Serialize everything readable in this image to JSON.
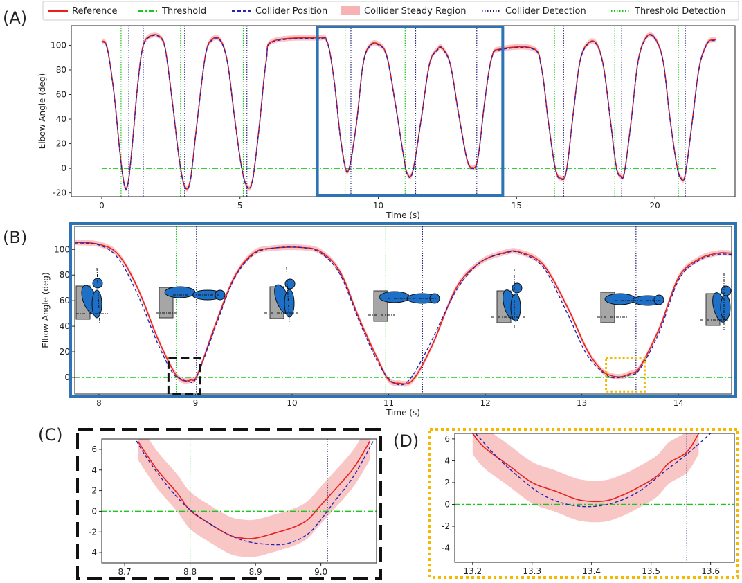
{
  "legend": {
    "entries": [
      {
        "label": "Reference",
        "style": "solid",
        "color": "#e8201c"
      },
      {
        "label": "Threshold",
        "style": "dashdot",
        "color": "#19c81c"
      },
      {
        "label": "Collider Position",
        "style": "dashed",
        "color": "#2323b4"
      },
      {
        "label": "Collider Steady Region",
        "style": "patch",
        "color": "#f7b3b3"
      },
      {
        "label": "Collider Detection",
        "style": "dotted",
        "color": "#23237a"
      },
      {
        "label": "Threshold Detection",
        "style": "dotted",
        "color": "#19c81c"
      }
    ]
  },
  "panel_labels": {
    "a": "(A)",
    "b": "(B)",
    "c": "(C)",
    "d": "(D)"
  },
  "colors": {
    "reference": "#e8201c",
    "collider": "#2323b4",
    "steady_band": "#f7b3b3",
    "threshold": "#19c81c",
    "collider_detection": "#23237a",
    "threshold_detection": "#19c81c",
    "highlight_blue": "#2e74b5",
    "highlight_black": "#111111",
    "highlight_orange": "#f5b800",
    "figure_arm": "#1e6fc6",
    "figure_body": "#a6a6a6"
  },
  "chart_data": [
    {
      "id": "A",
      "type": "line",
      "xlabel": "Time (s)",
      "ylabel": "Elbow Angle (deg)",
      "xlim": [
        -1.1,
        22.9
      ],
      "ylim": [
        -23,
        116
      ],
      "xticks": [
        0,
        5,
        10,
        15,
        20
      ],
      "yticks": [
        -20,
        0,
        20,
        40,
        60,
        80,
        100
      ],
      "threshold": 0,
      "band_halfwidth": 2.2,
      "reference_keypoints": [
        [
          0.0,
          103.5
        ],
        [
          0.2,
          98
        ],
        [
          0.45,
          60
        ],
        [
          0.65,
          15
        ],
        [
          0.82,
          -13.5
        ],
        [
          0.95,
          -12
        ],
        [
          1.1,
          18
        ],
        [
          1.3,
          68
        ],
        [
          1.5,
          100
        ],
        [
          1.8,
          108
        ],
        [
          2.1,
          107
        ],
        [
          2.3,
          97
        ],
        [
          2.55,
          55
        ],
        [
          2.8,
          8
        ],
        [
          3.0,
          -14.5
        ],
        [
          3.2,
          -10
        ],
        [
          3.45,
          38
        ],
        [
          3.75,
          92
        ],
        [
          4.0,
          105
        ],
        [
          4.3,
          104
        ],
        [
          4.55,
          86
        ],
        [
          4.8,
          42
        ],
        [
          5.05,
          2
        ],
        [
          5.25,
          -14.5
        ],
        [
          5.45,
          -10
        ],
        [
          5.7,
          35
        ],
        [
          5.95,
          88
        ],
        [
          6.2,
          103.5
        ],
        [
          7.8,
          106
        ],
        [
          8.15,
          103
        ],
        [
          8.4,
          72
        ],
        [
          8.65,
          22
        ],
        [
          8.9,
          -2.5
        ],
        [
          9.2,
          35
        ],
        [
          9.45,
          85
        ],
        [
          9.7,
          100
        ],
        [
          10.0,
          101
        ],
        [
          10.3,
          92
        ],
        [
          10.6,
          55
        ],
        [
          10.9,
          12
        ],
        [
          11.05,
          -4.5
        ],
        [
          11.25,
          -2
        ],
        [
          11.55,
          40
        ],
        [
          11.85,
          85
        ],
        [
          12.15,
          97
        ],
        [
          12.3,
          98
        ],
        [
          12.6,
          85
        ],
        [
          12.9,
          45
        ],
        [
          13.2,
          8
        ],
        [
          13.4,
          0.5
        ],
        [
          13.6,
          8
        ],
        [
          13.85,
          55
        ],
        [
          14.1,
          90
        ],
        [
          14.4,
          97
        ],
        [
          15.6,
          97.5
        ],
        [
          15.9,
          82
        ],
        [
          16.15,
          38
        ],
        [
          16.4,
          0
        ],
        [
          16.6,
          -8
        ],
        [
          16.8,
          -2
        ],
        [
          17.05,
          45
        ],
        [
          17.3,
          88
        ],
        [
          17.6,
          102
        ],
        [
          17.9,
          101
        ],
        [
          18.15,
          82
        ],
        [
          18.4,
          38
        ],
        [
          18.6,
          2
        ],
        [
          18.75,
          -6
        ],
        [
          18.9,
          -3
        ],
        [
          19.15,
          40
        ],
        [
          19.4,
          88
        ],
        [
          19.7,
          107
        ],
        [
          20.0,
          106
        ],
        [
          20.3,
          87
        ],
        [
          20.55,
          40
        ],
        [
          20.8,
          2
        ],
        [
          20.95,
          -8
        ],
        [
          21.1,
          -5
        ],
        [
          21.35,
          38
        ],
        [
          21.6,
          82
        ],
        [
          21.85,
          100
        ],
        [
          22.0,
          104
        ],
        [
          22.2,
          104.5
        ]
      ],
      "threshold_detection_x": [
        0.7,
        2.85,
        5.12,
        8.8,
        10.97,
        16.37,
        18.55,
        20.85
      ],
      "collider_detection_x": [
        0.98,
        1.5,
        3.0,
        5.25,
        9.01,
        11.35,
        13.56,
        16.7,
        18.8,
        21.1
      ],
      "highlight_box": {
        "x": [
          7.8,
          14.5
        ],
        "y": [
          -23,
          116
        ]
      }
    },
    {
      "id": "B",
      "type": "line",
      "xlabel": "Time (s)",
      "ylabel": "Elbow Angle (deg)",
      "xlim": [
        7.75,
        14.55
      ],
      "ylim": [
        -13,
        118
      ],
      "xticks": [
        8,
        9,
        10,
        11,
        12,
        13,
        14
      ],
      "yticks": [
        0,
        20,
        40,
        60,
        80,
        100
      ],
      "threshold": 0,
      "band_halfwidth": 2.2,
      "reference_keypoints": [
        [
          7.75,
          105.5
        ],
        [
          8.0,
          104
        ],
        [
          8.2,
          96
        ],
        [
          8.4,
          70
        ],
        [
          8.6,
          32
        ],
        [
          8.75,
          8
        ],
        [
          8.82,
          0
        ],
        [
          8.88,
          -2.6
        ],
        [
          8.95,
          -2
        ],
        [
          9.02,
          2
        ],
        [
          9.2,
          40
        ],
        [
          9.4,
          78
        ],
        [
          9.6,
          97
        ],
        [
          9.8,
          101
        ],
        [
          10.1,
          101.5
        ],
        [
          10.3,
          98
        ],
        [
          10.5,
          82
        ],
        [
          10.7,
          45
        ],
        [
          10.9,
          12
        ],
        [
          11.0,
          -2
        ],
        [
          11.1,
          -4.5
        ],
        [
          11.25,
          -2
        ],
        [
          11.45,
          25
        ],
        [
          11.7,
          70
        ],
        [
          11.95,
          90
        ],
        [
          12.2,
          97.5
        ],
        [
          12.35,
          98
        ],
        [
          12.6,
          88
        ],
        [
          12.85,
          55
        ],
        [
          13.05,
          22
        ],
        [
          13.2,
          6
        ],
        [
          13.3,
          1.5
        ],
        [
          13.4,
          0.5
        ],
        [
          13.5,
          3
        ],
        [
          13.6,
          8
        ],
        [
          13.8,
          38
        ],
        [
          14.0,
          78
        ],
        [
          14.2,
          92
        ],
        [
          14.4,
          97
        ],
        [
          14.55,
          97
        ]
      ],
      "collider_keypoints": [
        [
          7.75,
          105
        ],
        [
          8.0,
          103.5
        ],
        [
          8.2,
          93
        ],
        [
          8.4,
          65
        ],
        [
          8.6,
          28
        ],
        [
          8.75,
          5
        ],
        [
          8.82,
          0
        ],
        [
          8.93,
          -3.2
        ],
        [
          9.01,
          0
        ],
        [
          9.2,
          38
        ],
        [
          9.4,
          77
        ],
        [
          9.6,
          96
        ],
        [
          9.8,
          101
        ],
        [
          10.1,
          101.5
        ],
        [
          10.3,
          97
        ],
        [
          10.5,
          80
        ],
        [
          10.7,
          43
        ],
        [
          10.9,
          10
        ],
        [
          11.05,
          -4
        ],
        [
          11.2,
          -3
        ],
        [
          11.4,
          22
        ],
        [
          11.7,
          68
        ],
        [
          11.95,
          90
        ],
        [
          12.2,
          97
        ],
        [
          12.35,
          97.5
        ],
        [
          12.6,
          86
        ],
        [
          12.85,
          50
        ],
        [
          13.05,
          18
        ],
        [
          13.25,
          2
        ],
        [
          13.38,
          -0.2
        ],
        [
          13.5,
          2
        ],
        [
          13.6,
          6.5
        ],
        [
          13.8,
          35
        ],
        [
          14.0,
          76
        ],
        [
          14.2,
          91
        ],
        [
          14.4,
          96
        ],
        [
          14.55,
          96
        ]
      ],
      "threshold_detection_x": [
        8.8,
        10.97
      ],
      "collider_detection_x": [
        9.01,
        11.35,
        13.56
      ],
      "zoom_box_black": {
        "x": [
          8.72,
          9.05
        ],
        "y": [
          -13,
          15
        ]
      },
      "zoom_box_orange": {
        "x": [
          13.25,
          13.65
        ],
        "y": [
          -11,
          15
        ]
      }
    },
    {
      "id": "C",
      "type": "line",
      "xlim": [
        8.665,
        9.085
      ],
      "ylim": [
        -5,
        7
      ],
      "xticks": [
        8.7,
        8.8,
        8.9,
        9.0
      ],
      "xtick_labels": [
        "8.7",
        "8.8",
        "8.9",
        "9.0"
      ],
      "yticks": [
        -4,
        -2,
        0,
        2,
        4,
        6
      ],
      "threshold": 0,
      "band_halfwidth": 1.8,
      "reference_keypoints": [
        [
          8.72,
          6.8
        ],
        [
          8.75,
          4.0
        ],
        [
          8.78,
          1.8
        ],
        [
          8.8,
          0.1
        ],
        [
          8.83,
          -1.2
        ],
        [
          8.86,
          -2.3
        ],
        [
          8.88,
          -2.6
        ],
        [
          8.9,
          -2.6
        ],
        [
          8.93,
          -2.1
        ],
        [
          8.96,
          -1.5
        ],
        [
          8.98,
          -0.8
        ],
        [
          9.0,
          0.6
        ],
        [
          9.02,
          2.0
        ],
        [
          9.05,
          4.2
        ],
        [
          9.075,
          6.8
        ]
      ],
      "collider_keypoints": [
        [
          8.718,
          6.8
        ],
        [
          8.74,
          4.6
        ],
        [
          8.77,
          2.1
        ],
        [
          8.8,
          0.15
        ],
        [
          8.84,
          -1.6
        ],
        [
          8.88,
          -2.8
        ],
        [
          8.92,
          -3.2
        ],
        [
          8.95,
          -3.1
        ],
        [
          8.98,
          -2.2
        ],
        [
          9.0,
          -0.8
        ],
        [
          9.02,
          0.9
        ],
        [
          9.05,
          3.4
        ],
        [
          9.08,
          6.8
        ]
      ],
      "threshold_detection_x": [
        8.8
      ],
      "collider_detection_x": [
        9.01
      ]
    },
    {
      "id": "D",
      "type": "line",
      "xlim": [
        13.17,
        13.64
      ],
      "ylim": [
        -5.3,
        6.5
      ],
      "xticks": [
        13.2,
        13.3,
        13.4,
        13.5,
        13.6
      ],
      "xtick_labels": [
        "13.2",
        "13.3",
        "13.4",
        "13.5",
        "13.6"
      ],
      "yticks": [
        -4,
        -2,
        0,
        2,
        4,
        6
      ],
      "threshold": 0,
      "band_halfwidth": 1.9,
      "reference_keypoints": [
        [
          13.2,
          6.5
        ],
        [
          13.22,
          5.2
        ],
        [
          13.26,
          3.6
        ],
        [
          13.3,
          2.0
        ],
        [
          13.34,
          1.2
        ],
        [
          13.38,
          0.4
        ],
        [
          13.42,
          0.3
        ],
        [
          13.45,
          0.8
        ],
        [
          13.48,
          1.6
        ],
        [
          13.51,
          2.6
        ],
        [
          13.53,
          3.8
        ],
        [
          13.56,
          4.8
        ],
        [
          13.58,
          6.5
        ]
      ],
      "collider_keypoints": [
        [
          13.205,
          6.5
        ],
        [
          13.24,
          4.4
        ],
        [
          13.28,
          2.4
        ],
        [
          13.32,
          0.8
        ],
        [
          13.36,
          0.0
        ],
        [
          13.4,
          -0.2
        ],
        [
          13.44,
          0.2
        ],
        [
          13.48,
          1.2
        ],
        [
          13.52,
          2.9
        ],
        [
          13.56,
          4.6
        ],
        [
          13.6,
          6.5
        ]
      ],
      "threshold_detection_x": [],
      "collider_detection_x": [
        13.56
      ]
    }
  ]
}
